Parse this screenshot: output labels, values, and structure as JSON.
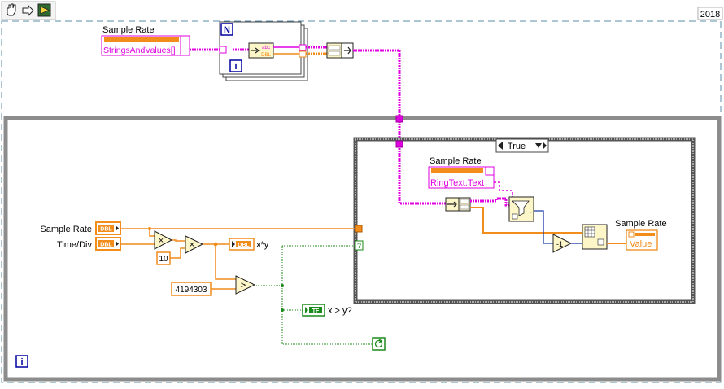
{
  "toolbar": {
    "year": "2018",
    "icons": [
      "hand-icon",
      "arrow-icon",
      "run-icon"
    ]
  },
  "diagram": {
    "top_control_label": "Sample Rate",
    "top_control_value": "StringsAndValues[]",
    "for_loop_count": "N",
    "for_loop_index": "i",
    "bundle_top": "abc",
    "bundle_bottom": "DBL",
    "case_selector": "True",
    "case_control_label": "Sample Rate",
    "case_control_value": "RingText.Text",
    "case_minus_one": "-1",
    "case_indicator_label": "Sample Rate",
    "case_indicator_value": "Value",
    "input_sample_rate_label": "Sample Rate",
    "input_time_div_label": "Time/Div",
    "dbl": "DBL",
    "const_ten": "10",
    "const_big": "4194303",
    "xy_label": "x*y",
    "gt_label": "x > y?",
    "tf": "TF",
    "question": "?",
    "while_index": "i",
    "multiply": "×",
    "greater": ">",
    "shift": "↩"
  },
  "colors": {
    "orange": "#f28c1a",
    "pink": "#e000e0",
    "green": "#1a8a1a",
    "blue": "#0000a0",
    "loop_gray": "#8c8c8c"
  }
}
